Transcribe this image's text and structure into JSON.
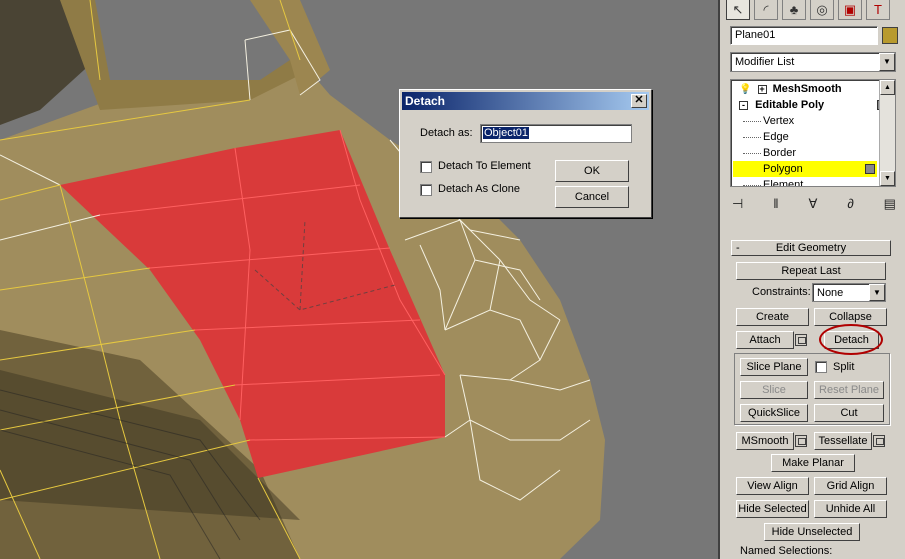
{
  "viewport": {},
  "dialog": {
    "title": "Detach",
    "detach_as_label": "Detach as:",
    "detach_as_value": "Object01",
    "detach_to_element": "Detach To Element",
    "detach_as_clone": "Detach As Clone",
    "ok": "OK",
    "cancel": "Cancel"
  },
  "panel": {
    "object_name": "Plane01",
    "object_color": "#b89a2e",
    "modifier_list": "Modifier List",
    "stack": [
      "MeshSmooth",
      "Editable Poly",
      "Vertex",
      "Edge",
      "Border",
      "Polygon",
      "Element"
    ],
    "edit_geometry": {
      "header": "Edit Geometry",
      "repeat_last": "Repeat Last",
      "constraints_label": "Constraints:",
      "constraints_value": "None",
      "create": "Create",
      "collapse": "Collapse",
      "attach": "Attach",
      "detach": "Detach",
      "slice_plane": "Slice Plane",
      "split": "Split",
      "slice": "Slice",
      "reset_plane": "Reset Plane",
      "quickslice": "QuickSlice",
      "cut": "Cut",
      "msmooth": "MSmooth",
      "tessellate": "Tessellate",
      "make_planar": "Make Planar",
      "view_align": "View Align",
      "grid_align": "Grid Align",
      "hide_selected": "Hide Selected",
      "unhide_all": "Unhide All",
      "hide_unselected": "Hide Unselected",
      "named_selections": "Named Selections:"
    }
  },
  "colors": {
    "mesh": "#b89a45",
    "selected_polys": "#d93a3a",
    "highlight": "#ffff00",
    "annotation_circle": "#b00000"
  }
}
